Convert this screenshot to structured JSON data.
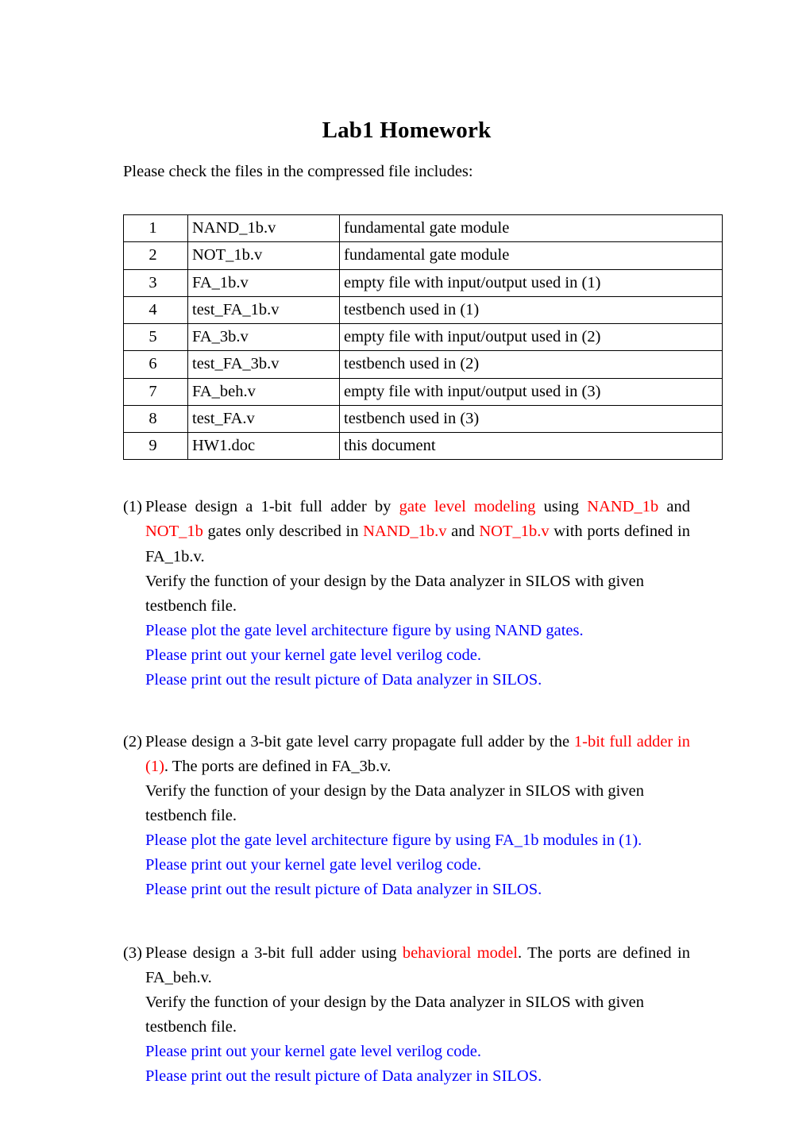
{
  "document": {
    "title": "Lab1 Homework",
    "intro": "Please check the files in the compressed file includes:"
  },
  "colors": {
    "emphasis_red": "#FF0000",
    "instruction_blue": "#0000FF",
    "text": "#000000",
    "page_background": "#FFFFFF",
    "table_border": "#000000"
  },
  "file_table": {
    "rows": [
      {
        "index": "1",
        "file": "NAND_1b.v",
        "description": "fundamental gate module"
      },
      {
        "index": "2",
        "file": "NOT_1b.v",
        "description": "fundamental gate module"
      },
      {
        "index": "3",
        "file": "FA_1b.v",
        "description": "empty file with input/output used in (1)"
      },
      {
        "index": "4",
        "file": "test_FA_1b.v",
        "description": "testbench used in (1)"
      },
      {
        "index": "5",
        "file": "FA_3b.v",
        "description": "empty file with input/output used in (2)"
      },
      {
        "index": "6",
        "file": "test_FA_3b.v",
        "description": "testbench used in (2)"
      },
      {
        "index": "7",
        "file": "FA_beh.v",
        "description": "empty file with input/output used in (3)"
      },
      {
        "index": "8",
        "file": "test_FA.v",
        "description": "testbench used in (3)"
      },
      {
        "index": "9",
        "file": "HW1.doc",
        "description": "this document"
      }
    ]
  },
  "sections": [
    {
      "marker": "(1)",
      "main_t1": "Please design a 1-bit full adder by ",
      "main_r1": "gate level modeling",
      "main_t2": " using ",
      "main_r2": "NAND_1b",
      "main_t3": " and ",
      "main_r3": "NOT_1b",
      "main_t4": " gates only described in ",
      "main_r4": "NAND_1b.v",
      "main_t5": " and ",
      "main_r5": "NOT_1b.v",
      "main_t6": " with ports defined in FA_1b.v.",
      "verify": "Verify the function of your design by the Data analyzer in SILOS with given testbench file.",
      "blue_lines": [
        "Please plot the gate level architecture figure by using NAND gates.",
        "Please print out your kernel gate level verilog code.",
        "Please print out the result picture of Data analyzer in SILOS."
      ]
    },
    {
      "marker": "(2)",
      "main_t1": "Please design a 3-bit gate level carry propagate full adder by the ",
      "main_r1": "1-bit full adder in (1)",
      "main_t2": ". The ports are defined in FA_3b.v.",
      "verify": "Verify the function of your design by the Data analyzer in SILOS with given testbench file.",
      "blue_lines": [
        "Please plot the gate level architecture figure by using FA_1b modules in (1).",
        "Please print out your kernel gate level verilog code.",
        "Please print out the result picture of Data analyzer in SILOS."
      ]
    },
    {
      "marker": "(3)",
      "main_t1": "Please design a 3-bit full adder using ",
      "main_r1": "behavioral model",
      "main_t2": ". The ports are defined in FA_beh.v.",
      "verify": "Verify the function of your design by the Data analyzer in SILOS with given testbench file.",
      "blue_lines": [
        "Please print out your kernel gate level verilog code.",
        "Please print out the result picture of Data analyzer in SILOS."
      ]
    }
  ]
}
